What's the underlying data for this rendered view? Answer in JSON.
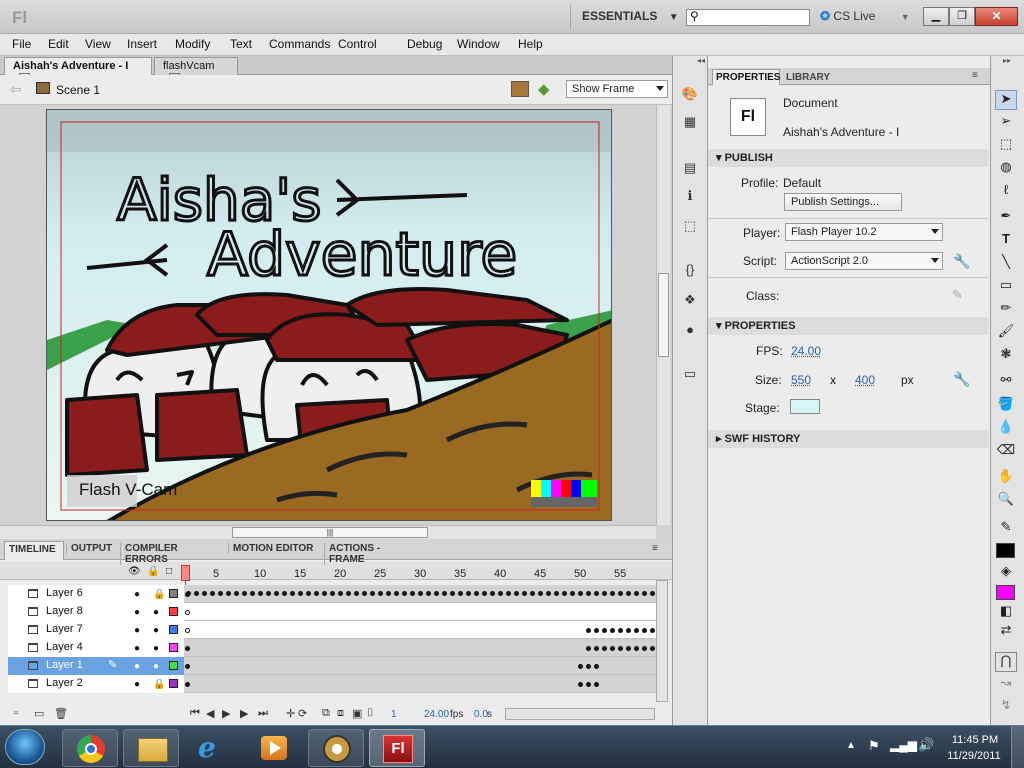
{
  "app": {
    "logo": "Fl",
    "workspace": "ESSENTIALS",
    "search_placeholder": "",
    "cs_live": "CS Live"
  },
  "menu": [
    "File",
    "Edit",
    "View",
    "Insert",
    "Modify",
    "Text",
    "Commands",
    "Control",
    "Debug",
    "Window",
    "Help"
  ],
  "doc_tabs": [
    "Aishah's Adventure - I",
    "flashVcam"
  ],
  "editbar": {
    "scene": "Scene 1",
    "zoom": "Show Frame"
  },
  "stage_art": {
    "title_line1": "Aisha's",
    "title_line2": "Adventure",
    "watermark": "Flash V-Cam"
  },
  "bottom_tabs": [
    "TIMELINE",
    "OUTPUT",
    "COMPILER ERRORS",
    "MOTION EDITOR",
    "ACTIONS - FRAME"
  ],
  "timeline": {
    "frame_ticks": [
      "1",
      "5",
      "10",
      "15",
      "20",
      "25",
      "30",
      "35",
      "40",
      "45",
      "50",
      "55"
    ],
    "layers": [
      {
        "name": "Layer 6",
        "color": "#808080",
        "locked": true
      },
      {
        "name": "Layer 8",
        "color": "#ff4444",
        "locked": false
      },
      {
        "name": "Layer 7",
        "color": "#4477ff",
        "locked": false
      },
      {
        "name": "Layer 4",
        "color": "#ff44ff",
        "locked": false
      },
      {
        "name": "Layer 1",
        "color": "#44dd44",
        "locked": false,
        "selected": true
      },
      {
        "name": "Layer 2",
        "color": "#9933cc",
        "locked": true
      }
    ],
    "current_frame": "1",
    "fps": "24.00",
    "fps_unit": "fps",
    "elapsed": "0.0",
    "elapsed_unit": "s"
  },
  "properties": {
    "tabs": [
      "PROPERTIES",
      "LIBRARY"
    ],
    "doc_type": "Document",
    "doc_name": "Aishah's Adventure - I",
    "publish_header": "PUBLISH",
    "profile_label": "Profile:",
    "profile_value": "Default",
    "publish_settings": "Publish Settings...",
    "player_label": "Player:",
    "player_value": "Flash Player 10.2",
    "script_label": "Script:",
    "script_value": "ActionScript 2.0",
    "class_label": "Class:",
    "props_header": "PROPERTIES",
    "fps_label": "FPS:",
    "fps_value": "24.00",
    "size_label": "Size:",
    "width": "550",
    "x": "x",
    "height": "400",
    "unit": "px",
    "stage_label": "Stage:",
    "stage_color": "#d9f6f6",
    "swf_header": "SWF HISTORY"
  },
  "clock": {
    "time": "11:45 PM",
    "date": "11/29/2011"
  },
  "colors": {
    "stroke": "#000000",
    "fill": "#ff00ff"
  }
}
